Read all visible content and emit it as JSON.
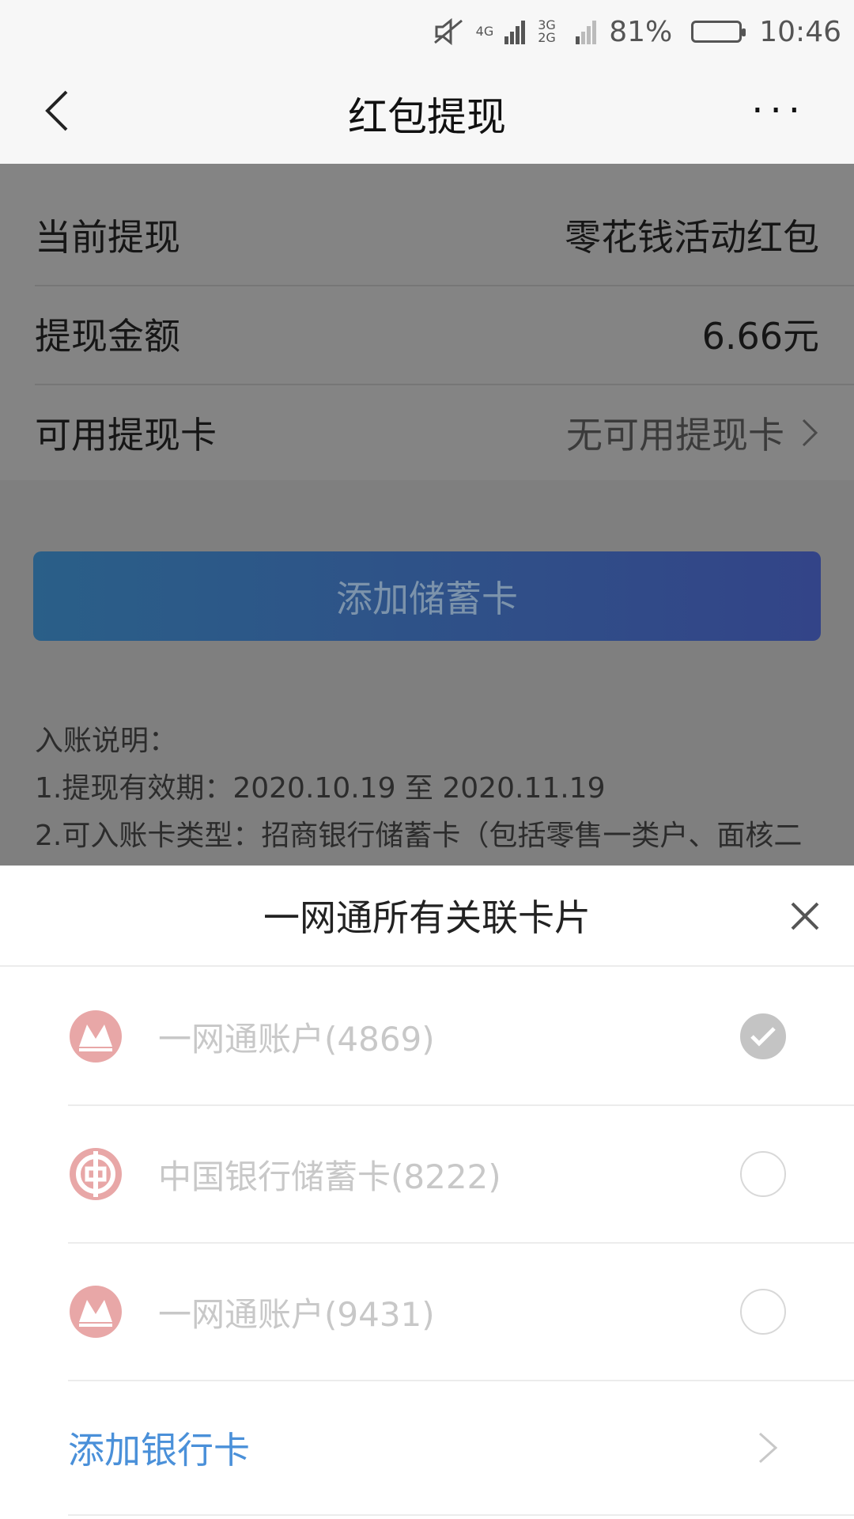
{
  "status_bar": {
    "network1": "4G",
    "network2": "3G 2G",
    "battery_percent": "81%",
    "battery_level": 0.81,
    "time": "10:46",
    "icons": [
      "mute-icon",
      "signal-icon",
      "signal-icon",
      "battery-icon"
    ]
  },
  "header": {
    "title": "红包提现",
    "back_icon": "back-arrow-icon",
    "more_label": "···"
  },
  "info": {
    "rows": [
      {
        "label": "当前提现",
        "value": "零花钱活动红包"
      },
      {
        "label": "提现金额",
        "value": "6.66元"
      },
      {
        "label": "可用提现卡",
        "value": "无可用提现卡"
      }
    ]
  },
  "add_debit_card_label": "添加储蓄卡",
  "notes": {
    "title": "入账说明：",
    "line1": "1.提现有效期：2020.10.19 至 2020.11.19",
    "line2": "2.可入账卡类型：招商银行储蓄卡（包括零售一类户、面核二"
  },
  "sheet": {
    "title": "一网通所有关联卡片",
    "cards": [
      {
        "name": "一网通账户(4869)",
        "logo": "cmb-logo-icon",
        "selected": true
      },
      {
        "name": "中国银行储蓄卡(8222)",
        "logo": "boc-logo-icon",
        "selected": false
      },
      {
        "name": "一网通账户(9431)",
        "logo": "cmb-logo-icon",
        "selected": false
      }
    ],
    "add_bank_label": "添加银行卡"
  },
  "colors": {
    "accent": "#4a90d9",
    "overlay": "#7f7f7f",
    "logo": "#e8a7a7"
  }
}
